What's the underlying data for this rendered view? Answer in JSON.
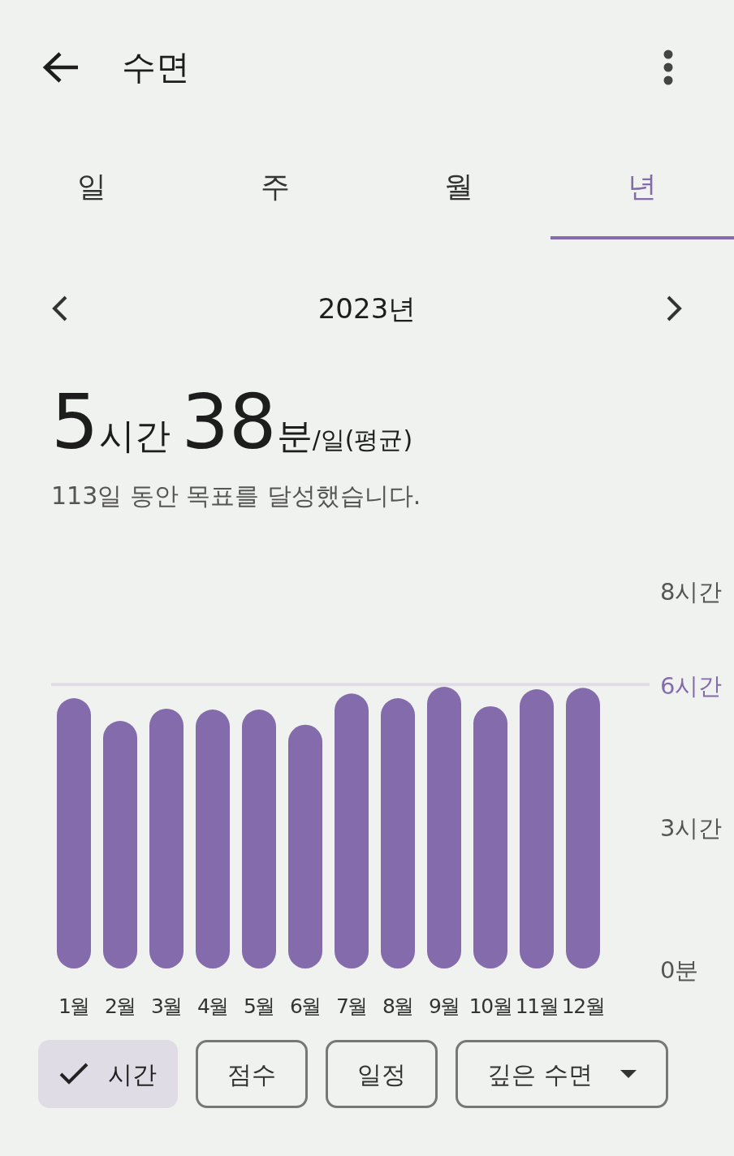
{
  "app_bar": {
    "title": "수면"
  },
  "tabs": [
    {
      "label": "일",
      "selected": false
    },
    {
      "label": "주",
      "selected": false
    },
    {
      "label": "월",
      "selected": false
    },
    {
      "label": "년",
      "selected": true
    }
  ],
  "period": {
    "label": "2023년"
  },
  "summary": {
    "hours": "5",
    "hours_unit": "시간",
    "minutes": "38",
    "minutes_unit": "분",
    "suffix": "/일(평균)",
    "note": "113일 동안 목표를 달성했습니다."
  },
  "chart": {
    "chart_data": {
      "type": "bar",
      "categories": [
        "1월",
        "2월",
        "3월",
        "4월",
        "5월",
        "6월",
        "7월",
        "8월",
        "9월",
        "10월",
        "11월",
        "12월"
      ],
      "series": [
        {
          "color": "#846bab",
          "values": [
            5.71,
            5.23,
            5.49,
            5.47,
            5.47,
            5.15,
            5.81,
            5.71,
            5.95,
            5.54,
            5.9,
            5.93
          ]
        }
      ],
      "ylim": [
        0,
        8
      ],
      "yticks": [
        {
          "value": 0,
          "label": "0분"
        },
        {
          "value": 3,
          "label": "3시간"
        },
        {
          "value": 6,
          "label": "6시간"
        },
        {
          "value": 8,
          "label": "8시간"
        }
      ],
      "ref_lines": [
        {
          "axis": "y",
          "value": 6
        }
      ]
    }
  },
  "chips": [
    {
      "kind": "toggle",
      "label": "시간",
      "selected": true
    },
    {
      "kind": "toggle",
      "label": "점수",
      "selected": false
    },
    {
      "kind": "toggle",
      "label": "일정",
      "selected": false
    },
    {
      "kind": "dropdown",
      "label": "깊은 수면",
      "selected": false
    }
  ]
}
